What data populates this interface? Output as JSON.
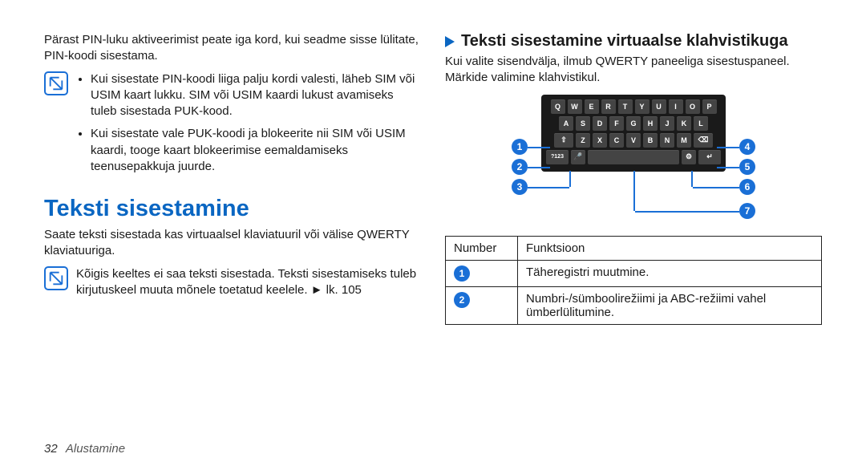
{
  "left": {
    "intro": "Pärast PIN-luku aktiveerimist peate iga kord, kui seadme sisse lülitate, PIN-koodi sisestama.",
    "note_items": [
      "Kui sisestate PIN-koodi liiga palju kordi valesti, läheb SIM või USIM kaart lukku. SIM või USIM kaardi lukust avamiseks tuleb sisestada PUK-kood.",
      "Kui sisestate vale PUK-koodi ja blokeerite nii SIM või USIM kaardi, tooge kaart blokeerimise eemaldamiseks teenusepakkuja juurde."
    ],
    "h1": "Teksti sisestamine",
    "h1_para": "Saate teksti sisestada kas virtuaalsel klaviatuuril või välise QWERTY klaviatuuriga.",
    "note2": "Kõigis keeltes ei saa teksti sisestada. Teksti sisestamiseks tuleb kirjutuskeel muuta mõnele toetatud keelele. ► lk. 105"
  },
  "right": {
    "subhead": "Teksti sisestamine virtuaalse klahvistikuga",
    "subpara": "Kui valite sisendvälja, ilmub QWERTY paneeliga sisestuspaneel. Märkide valimine klahvistikul.",
    "keys": {
      "row1": [
        "Q",
        "W",
        "E",
        "R",
        "T",
        "Y",
        "U",
        "I",
        "O",
        "P"
      ],
      "row2": [
        "A",
        "S",
        "D",
        "F",
        "G",
        "H",
        "J",
        "K",
        "L"
      ],
      "row3_shift": "⇧",
      "row3": [
        "Z",
        "X",
        "C",
        "V",
        "B",
        "N",
        "M"
      ],
      "row3_bksp": "⌫",
      "row4_sym": "?123",
      "row4_mic": "🎤",
      "row4_gear": "⚙",
      "row4_enter": "↵"
    },
    "callouts": [
      "1",
      "2",
      "3",
      "4",
      "5",
      "6",
      "7"
    ],
    "table": {
      "head_num": "Number",
      "head_func": "Funktsioon",
      "rows": [
        {
          "n": "1",
          "f": "Täheregistri muutmine."
        },
        {
          "n": "2",
          "f": "Numbri-/sümboolirežiimi ja ABC-režiimi vahel ümberlülitumine."
        }
      ]
    }
  },
  "footer": {
    "page": "32",
    "section": "Alustamine"
  }
}
